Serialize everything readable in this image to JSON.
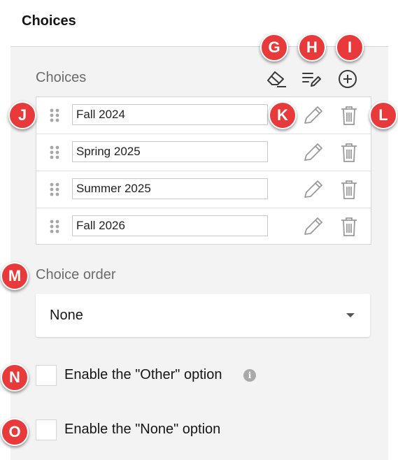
{
  "section": {
    "title": "Choices"
  },
  "choices": {
    "label": "Choices",
    "toolbar": {
      "clear_icon": "eraser-icon",
      "edit_all_icon": "list-edit-icon",
      "add_icon": "plus-circle-icon"
    },
    "items": [
      {
        "value": "Fall 2024"
      },
      {
        "value": "Spring 2025"
      },
      {
        "value": "Summer 2025"
      },
      {
        "value": "Fall 2026"
      }
    ],
    "row_icons": {
      "drag": "drag-handle-icon",
      "edit": "pencil-icon",
      "delete": "trash-icon"
    }
  },
  "choice_order": {
    "label": "Choice order",
    "selected": "None"
  },
  "options": {
    "other": {
      "label": "Enable the \"Other\" option",
      "info": "i"
    },
    "none": {
      "label": "Enable the \"None\" option"
    }
  },
  "markers": [
    "G",
    "H",
    "I",
    "J",
    "K",
    "L",
    "M",
    "N",
    "O"
  ],
  "colors": {
    "marker": "#e8393b",
    "panel": "#f3f3f3",
    "icon": "#8a8a8a"
  }
}
